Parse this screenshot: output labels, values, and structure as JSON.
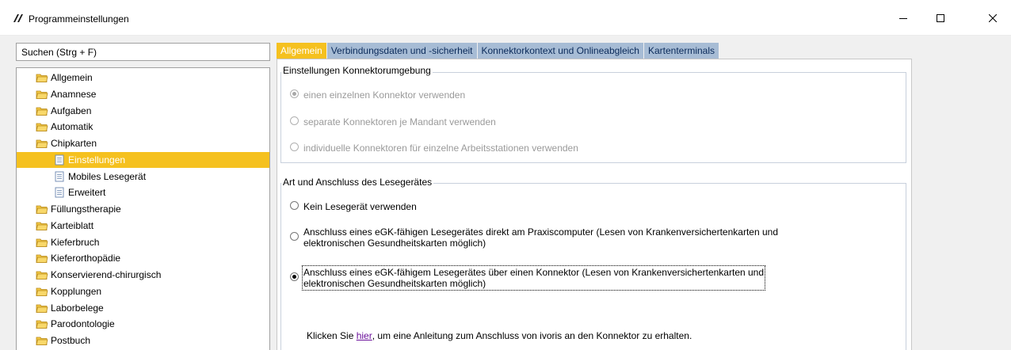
{
  "window": {
    "title": "Programmeinstellungen",
    "icon": "app-logo-icon"
  },
  "search": {
    "value": "Suchen (Strg + F)"
  },
  "tree": {
    "items": [
      {
        "label": "Allgemein",
        "type": "folder"
      },
      {
        "label": "Anamnese",
        "type": "folder"
      },
      {
        "label": "Aufgaben",
        "type": "folder"
      },
      {
        "label": "Automatik",
        "type": "folder"
      },
      {
        "label": "Chipkarten",
        "type": "folder-open"
      },
      {
        "label": "Einstellungen",
        "type": "page",
        "selected": true
      },
      {
        "label": "Mobiles Lesegerät",
        "type": "page"
      },
      {
        "label": "Erweitert",
        "type": "page"
      },
      {
        "label": "Füllungstherapie",
        "type": "folder"
      },
      {
        "label": "Karteiblatt",
        "type": "folder"
      },
      {
        "label": "Kieferbruch",
        "type": "folder"
      },
      {
        "label": "Kieferorthopädie",
        "type": "folder"
      },
      {
        "label": "Konservierend-chirurgisch",
        "type": "folder"
      },
      {
        "label": "Kopplungen",
        "type": "folder"
      },
      {
        "label": "Laborbelege",
        "type": "folder"
      },
      {
        "label": "Parodontologie",
        "type": "folder"
      },
      {
        "label": "Postbuch",
        "type": "folder"
      }
    ]
  },
  "tabs": [
    {
      "label": "Allgemein",
      "active": true
    },
    {
      "label": "Verbindungsdaten und -sicherheit"
    },
    {
      "label": "Konnektorkontext und Onlineabgleich"
    },
    {
      "label": "Kartenterminals"
    }
  ],
  "group1": {
    "title": "Einstellungen Konnektorumgebung",
    "options": [
      {
        "label": "einen einzelnen Konnektor verwenden",
        "checked": true
      },
      {
        "label": "separate Konnektoren je Mandant verwenden",
        "checked": false
      },
      {
        "label": "individuelle Konnektoren für einzelne Arbeitsstationen verwenden",
        "checked": false
      }
    ]
  },
  "group2": {
    "title": "Art und Anschluss des Lesegerätes",
    "options": [
      {
        "line1": "Kein Lesegerät verwenden",
        "line2": "",
        "checked": false
      },
      {
        "line1": "Anschluss eines eGK-fähigen Lesegerätes direkt am Praxiscomputer (Lesen von Krankenversichertenkarten und",
        "line2": "elektronischen Gesundheitskarten möglich)",
        "checked": false
      },
      {
        "line1": "Anschluss eines eGK-fähigem Lesegerätes über einen Konnektor (Lesen von Krankenversichertenkarten und",
        "line2": "elektronischen Gesundheitskarten möglich)",
        "checked": true
      }
    ],
    "hint": {
      "before": "Klicken Sie ",
      "link": "hier",
      "after": ", um eine Anleitung zum Anschluss von ivoris an den Konnektor zu erhalten."
    }
  },
  "colors": {
    "accent": "#f5c11f",
    "tab_inactive": "#a7bcd5",
    "link": "#6a0f9a"
  }
}
